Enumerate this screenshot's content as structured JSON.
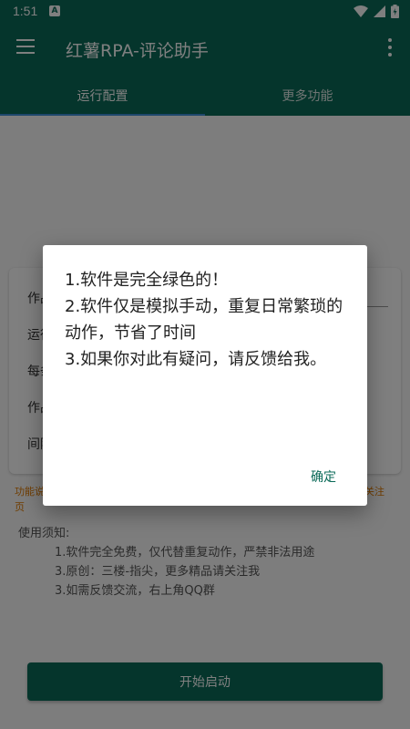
{
  "status_bar": {
    "time": "1:51",
    "notif_letter": "A"
  },
  "app_bar": {
    "title": "红薯RPA-评论助手"
  },
  "tabs": [
    {
      "label": "运行配置"
    },
    {
      "label": "更多功能"
    }
  ],
  "form": {
    "rows": [
      {
        "label": "作品"
      },
      {
        "label": "运行"
      },
      {
        "label": "每条"
      },
      {
        "label": "作品"
      },
      {
        "label": "间隔"
      }
    ]
  },
  "hint": {
    "left": "功能说",
    "right": "关注",
    "wrap": "页"
  },
  "notes": {
    "title": "使用须知:",
    "items": [
      "1.软件完全免费，仅代替重复动作，严禁非法用途",
      "3.原创：三楼-指尖，更多精品请关注我",
      "3.如需反馈交流，右上角QQ群"
    ]
  },
  "start_button": {
    "label": "开始启动"
  },
  "dialog": {
    "lines": [
      "1.软件是完全绿色的！",
      "2.软件仅是模拟手动，重复日常繁琐的动作，节省了时间",
      "3.如果你对此有疑问，请反馈给我。"
    ],
    "ok_label": "确定"
  },
  "colors": {
    "primary": "#0b6a58",
    "tab_indicator": "#3a8fd9",
    "hint": "#e07b00"
  }
}
